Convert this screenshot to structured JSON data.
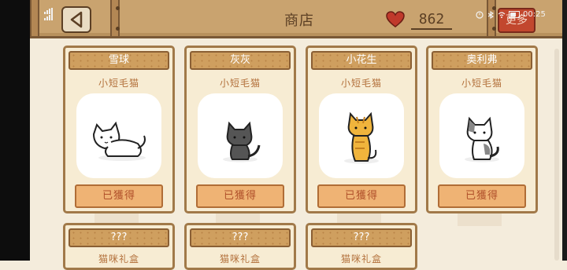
{
  "header": {
    "title": "商店",
    "hearts": "862",
    "more_label": "更多"
  },
  "status_bar": {
    "time": "00:25"
  },
  "colors": {
    "wood": "#c9a36f",
    "card_bg": "#f7ecd3",
    "button_orange": "#efb374",
    "heart_red": "#c0392b",
    "more_red": "#c2472e"
  },
  "cats": [
    {
      "name": "雪球",
      "breed": "小短毛猫",
      "status": "已獲得",
      "icon": "white-cat-icon"
    },
    {
      "name": "灰灰",
      "breed": "小短毛猫",
      "status": "已獲得",
      "icon": "gray-cat-icon"
    },
    {
      "name": "小花生",
      "breed": "小短毛猫",
      "status": "已獲得",
      "icon": "orange-tabby-cat-icon"
    },
    {
      "name": "奥利弗",
      "breed": "小短毛猫",
      "status": "已獲得",
      "icon": "calico-cat-icon"
    }
  ],
  "locked_cards": [
    {
      "name": "???",
      "category": "猫咪礼盒"
    },
    {
      "name": "???",
      "category": "猫咪礼盒"
    },
    {
      "name": "???",
      "category": "猫咪礼盒"
    }
  ]
}
